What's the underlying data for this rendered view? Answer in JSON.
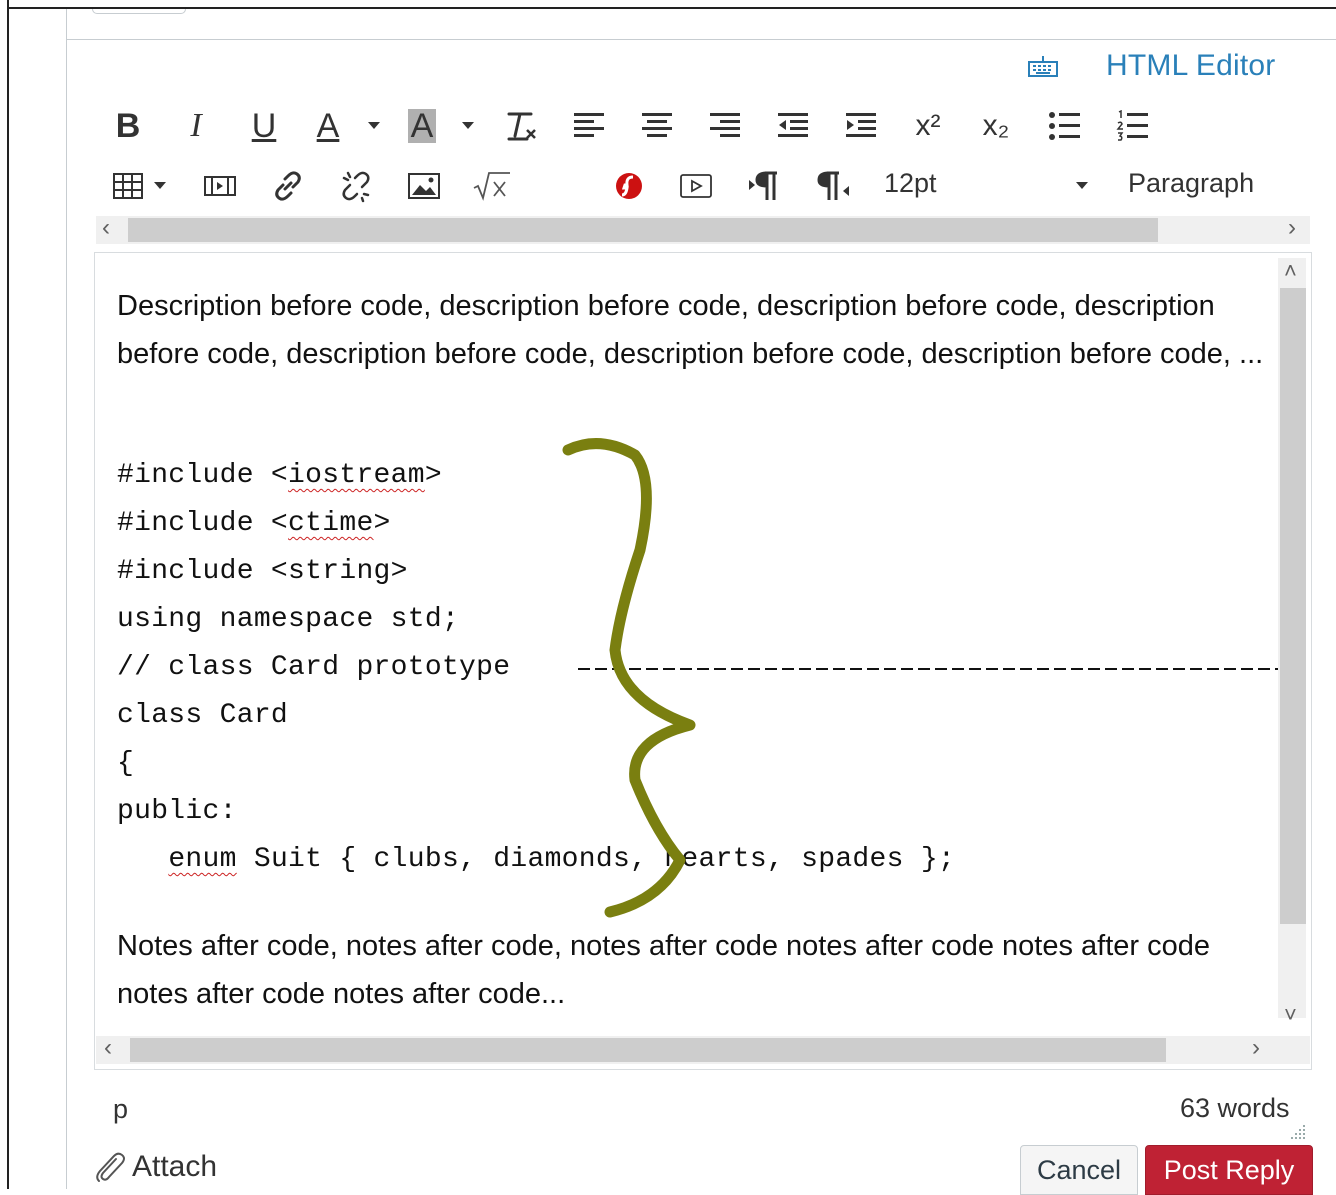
{
  "editor_links": {
    "html_editor_label": "HTML Editor",
    "keyboard_icon": "keyboard-icon"
  },
  "toolbar": {
    "row1": [
      {
        "name": "bold",
        "label": "B"
      },
      {
        "name": "italic",
        "label": "I"
      },
      {
        "name": "underline",
        "label": "U"
      },
      {
        "name": "text-color",
        "label": "A"
      },
      {
        "name": "background-color",
        "label": "A"
      },
      {
        "name": "clear-formatting",
        "label": "Tx"
      },
      {
        "name": "align-left",
        "icon": "align-left-icon"
      },
      {
        "name": "align-center",
        "icon": "align-center-icon"
      },
      {
        "name": "align-right",
        "icon": "align-right-icon"
      },
      {
        "name": "outdent",
        "icon": "outdent-icon"
      },
      {
        "name": "indent",
        "icon": "indent-icon"
      },
      {
        "name": "superscript",
        "label": "x²"
      },
      {
        "name": "subscript",
        "label": "x₂"
      },
      {
        "name": "bulleted-list",
        "icon": "bulleted-list-icon"
      },
      {
        "name": "numbered-list",
        "icon": "numbered-list-icon"
      }
    ],
    "row2_icons": [
      "table-icon",
      "media-icon",
      "link-icon",
      "unlink-icon",
      "image-icon",
      "equation-icon",
      "flash-icon",
      "embed-video-icon",
      "ltr-paragraph-icon",
      "rtl-paragraph-icon"
    ],
    "font_size": "12pt",
    "block_format": "Paragraph"
  },
  "content": {
    "description": "Description before code, description before code, description before code, description before code, description before code, description before code, description before code, ...",
    "code_lines": [
      "#include <iostream>",
      "#include <ctime>",
      "#include <string>",
      "using namespace std;",
      "// class Card prototype ",
      "class Card",
      "{",
      "public:",
      "   enum Suit { clubs, diamonds, hearts, spades };"
    ],
    "notes": "Notes after code, notes after code, notes after code notes after code notes after code notes after code notes after code..."
  },
  "annotation": {
    "color": "#7a7f10",
    "shape": "curly-brace"
  },
  "status": {
    "path": "p",
    "word_count": "63 words"
  },
  "actions": {
    "attach_label": "Attach",
    "cancel_label": "Cancel",
    "post_label": "Post Reply"
  },
  "colors": {
    "link": "#2a80b9",
    "primary_button": "#bf2234"
  }
}
